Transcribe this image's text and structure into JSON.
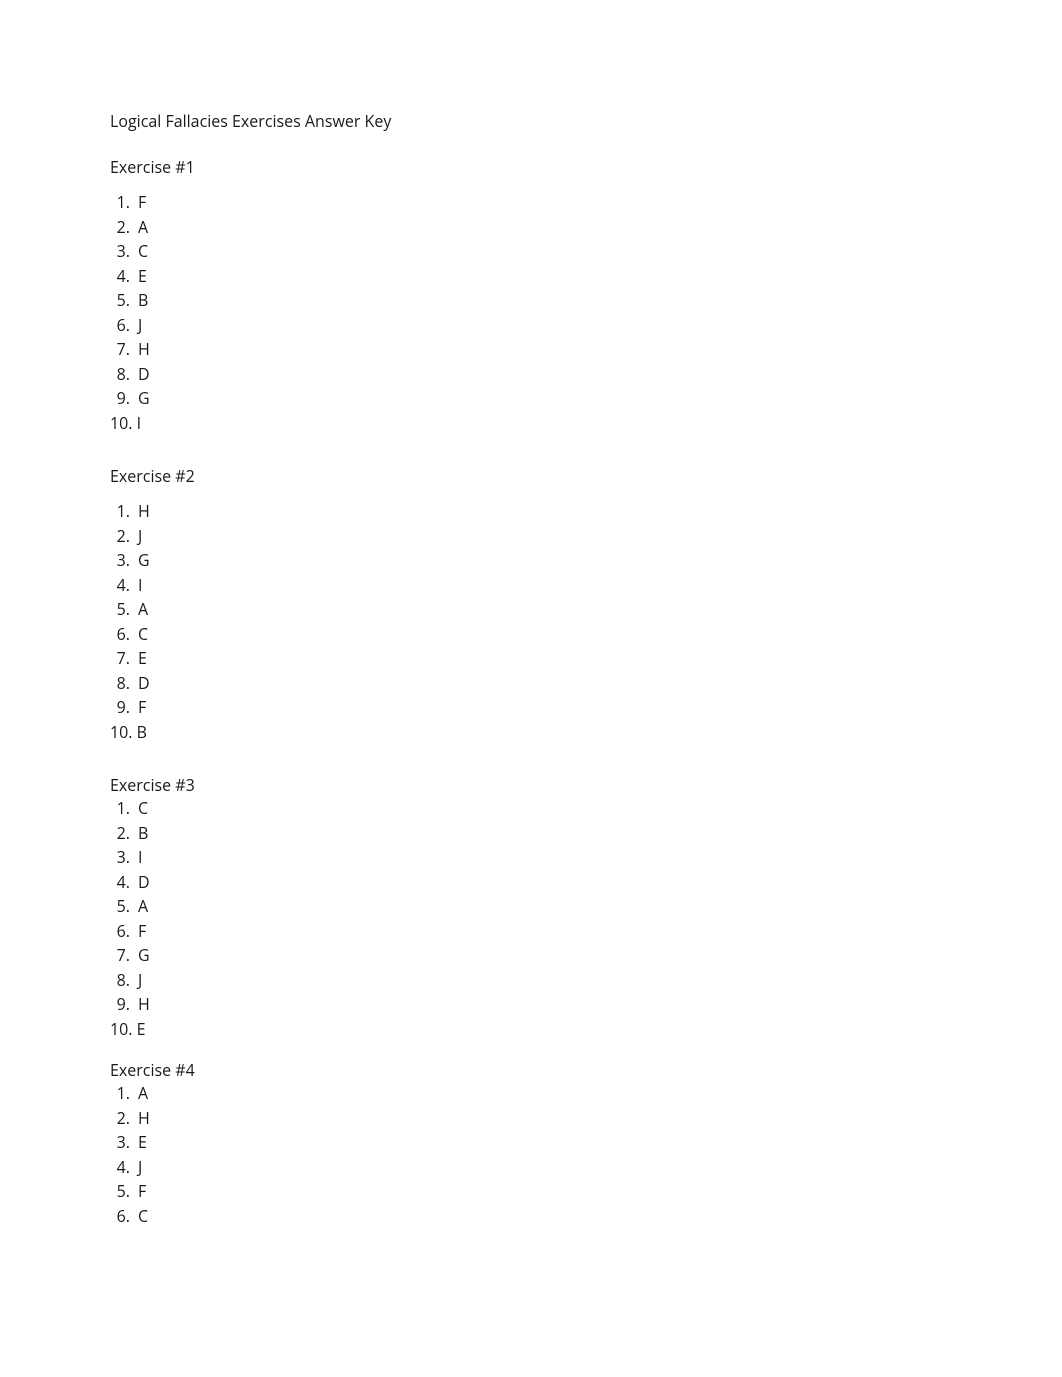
{
  "title": "Logical Fallacies Exercises Answer Key",
  "exercises": [
    {
      "heading": "Exercise #1",
      "spaced": true,
      "answers": [
        "F",
        "A",
        "C",
        "E",
        "B",
        "J",
        "H",
        "D",
        "G",
        "I"
      ]
    },
    {
      "heading": "Exercise #2",
      "spaced": true,
      "answers": [
        "H",
        "J",
        "G",
        "I",
        "A",
        "C",
        "E",
        "D",
        "F",
        "B"
      ]
    },
    {
      "heading": "Exercise #3",
      "spaced": false,
      "answers": [
        "C",
        "B",
        "I",
        "D",
        "A",
        "F",
        "G",
        "J",
        "H",
        "E"
      ]
    },
    {
      "heading": "Exercise #4",
      "spaced": false,
      "answers": [
        "A",
        "H",
        "E",
        "J",
        "F",
        "C"
      ]
    }
  ]
}
